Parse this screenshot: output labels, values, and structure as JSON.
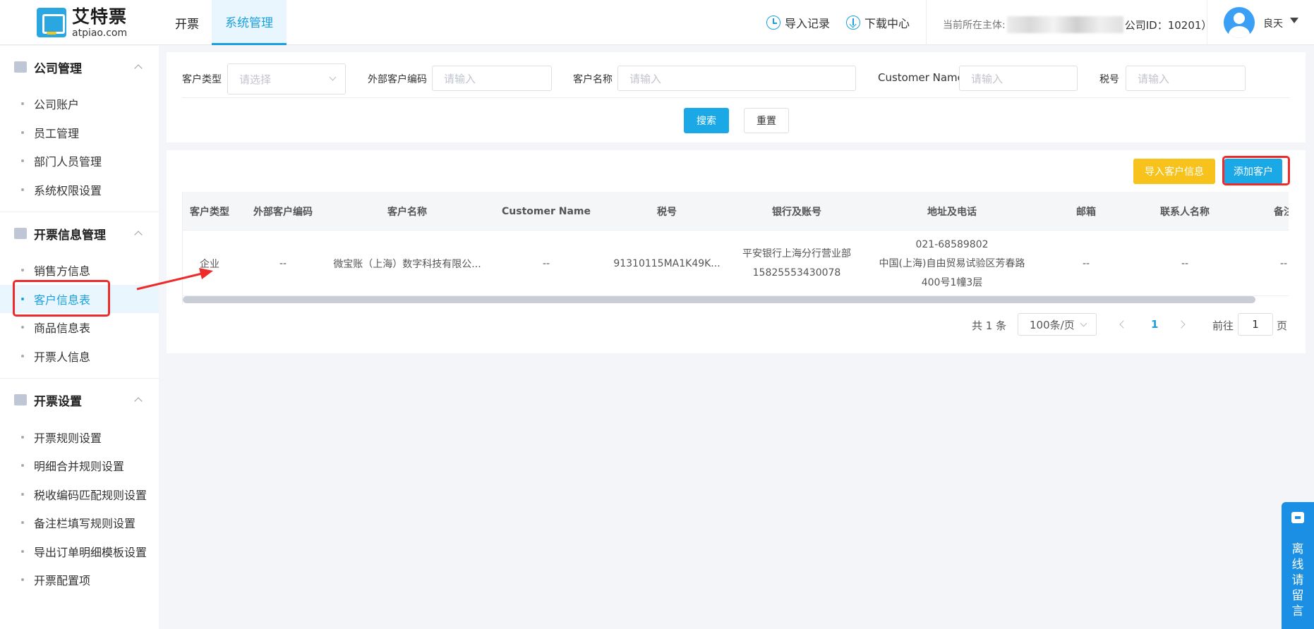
{
  "header": {
    "logo_cn": "艾特票",
    "logo_en": "atpiao.com",
    "nav": [
      "开票",
      "系统管理"
    ],
    "import_records": "导入记录",
    "download_center": "下载中心",
    "entity_prefix": "当前所在主体:",
    "entity_suffix": "公司ID：10201）",
    "username": "良天"
  },
  "sidebar": {
    "groups": [
      {
        "title": "公司管理",
        "items": [
          "公司账户",
          "员工管理",
          "部门人员管理",
          "系统权限设置"
        ]
      },
      {
        "title": "开票信息管理",
        "items": [
          "销售方信息",
          "客户信息表",
          "商品信息表",
          "开票人信息"
        ]
      },
      {
        "title": "开票设置",
        "items": [
          "开票规则设置",
          "明细合并规则设置",
          "税收编码匹配规则设置",
          "备注栏填写规则设置",
          "导出订单明细模板设置",
          "开票配置项"
        ]
      }
    ],
    "active_item": "客户信息表"
  },
  "search": {
    "customer_type_label": "客户类型",
    "customer_type_placeholder": "请选择",
    "external_code_label": "外部客户编码",
    "external_code_placeholder": "请输入",
    "customer_name_label": "客户名称",
    "customer_name_placeholder": "请输入",
    "customer_name_en_label": "Customer Name",
    "customer_name_en_placeholder": "请输入",
    "tax_no_label": "税号",
    "tax_no_placeholder": "请输入",
    "search_button": "搜索",
    "reset_button": "重置"
  },
  "actions": {
    "import_button": "导入客户信息",
    "add_button": "添加客户"
  },
  "table": {
    "columns": [
      "客户类型",
      "外部客户编码",
      "客户名称",
      "Customer Name",
      "税号",
      "银行及账号",
      "地址及电话",
      "邮箱",
      "联系人名称",
      "备注"
    ],
    "rows": [
      {
        "type": "企业",
        "external_code": "--",
        "name": "微宝账（上海）数字科技有限公...",
        "name_en": "--",
        "tax_no": "91310115MA1K49K...",
        "bank_line1": "平安银行上海分行营业部",
        "bank_line2": "15825553430078",
        "addr_line1": "021-68589802",
        "addr_line2": "中国(上海)自由贸易试验区芳春路",
        "addr_line3": "400号1幢3层",
        "email": "--",
        "contact": "--",
        "remark": "--"
      }
    ]
  },
  "pagination": {
    "total": "共 1 条",
    "page_size": "100条/页",
    "current_page": "1",
    "goto_label": "前往",
    "goto_value": "1",
    "page_unit": "页"
  },
  "float_tab": {
    "label": "离线请留言"
  },
  "colors": {
    "primary": "#1aa8e6",
    "warning": "#f7c21c",
    "annotation": "#ee2b2b"
  }
}
